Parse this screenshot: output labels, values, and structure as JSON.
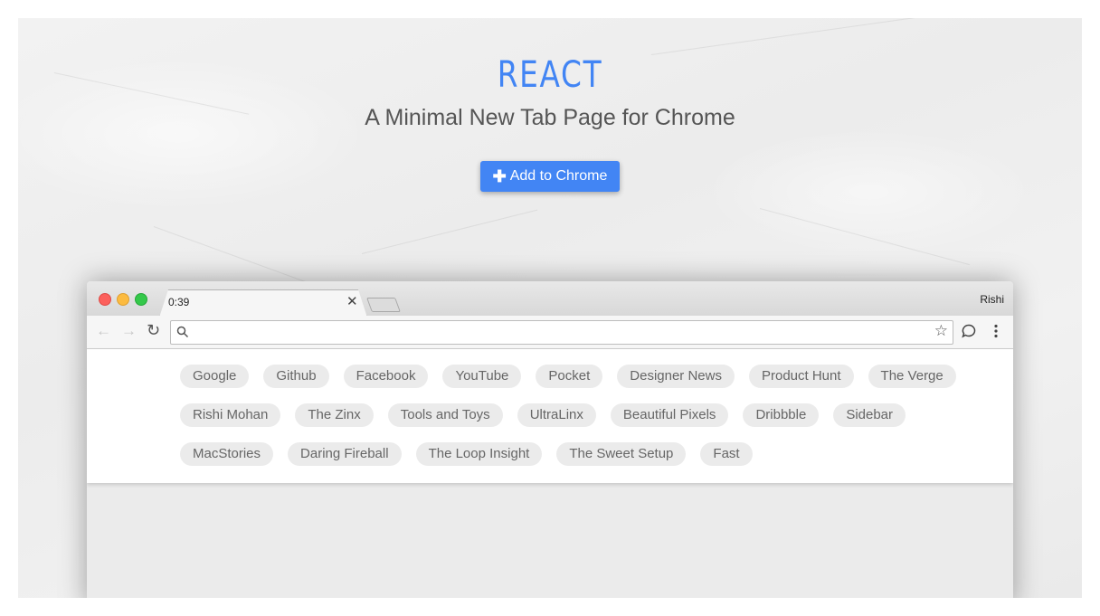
{
  "hero": {
    "title": "REACT",
    "subtitle": "A Minimal New Tab Page for Chrome",
    "button_label": "Add to Chrome",
    "button_icon": "plus-icon",
    "accent_color": "#4285f4"
  },
  "browser": {
    "tab_title": "0:39",
    "profile_name": "Rishi",
    "omnibox": {
      "value": "",
      "placeholder": ""
    },
    "icons": [
      "back-arrow-icon",
      "forward-arrow-icon",
      "reload-icon",
      "search-icon",
      "star-icon",
      "chat-bubble-icon",
      "kebab-menu-icon",
      "close-icon"
    ],
    "links": [
      "Google",
      "Github",
      "Facebook",
      "YouTube",
      "Pocket",
      "Designer News",
      "Product Hunt",
      "The Verge",
      "Rishi Mohan",
      "The Zinx",
      "Tools and Toys",
      "UltraLinx",
      "Beautiful Pixels",
      "Dribbble",
      "Sidebar",
      "MacStories",
      "Daring Fireball",
      "The Loop Insight",
      "The Sweet Setup",
      "Fast"
    ]
  }
}
